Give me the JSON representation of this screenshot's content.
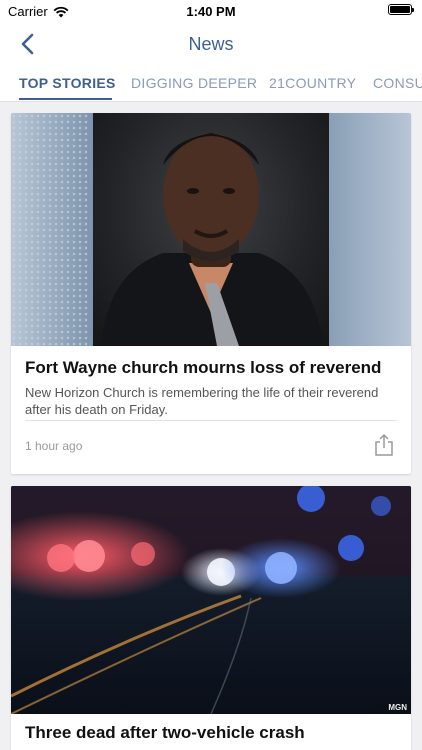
{
  "status_bar": {
    "carrier": "Carrier",
    "time": "1:40 PM",
    "wifi_icon": "wifi-icon",
    "battery_icon": "battery-icon"
  },
  "nav": {
    "title": "News",
    "back_icon": "back-chevron-icon"
  },
  "tabs": [
    {
      "label": "TOP STORIES",
      "active": true
    },
    {
      "label": "DIGGING DEEPER",
      "active": false
    },
    {
      "label": "21COUNTRY",
      "active": false
    },
    {
      "label": "CONSU",
      "active": false
    }
  ],
  "colors": {
    "accent": "#3e5f93",
    "tab_inactive": "#8a9ab8",
    "background": "#f0f0f3"
  },
  "articles": [
    {
      "headline": "Fort Wayne church mourns loss of reverend",
      "summary": "New Horizon Church is remembering the life of their reverend after his death on Friday.",
      "time": "1 hour ago",
      "share_icon": "share-icon"
    },
    {
      "headline": "Three dead after two-vehicle crash",
      "image_credit": "MGN"
    }
  ]
}
